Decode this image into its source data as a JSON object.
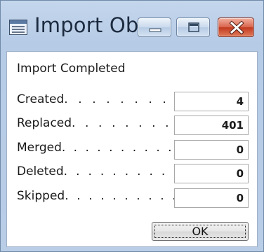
{
  "window": {
    "title": "Import Ob...",
    "icons": {
      "app": "dialog-app-icon",
      "minimize": "minimize-icon",
      "maximize": "maximize-icon",
      "close": "close-icon"
    },
    "colors": {
      "close_button": "#c23a1f",
      "frame": "#b9cde7"
    }
  },
  "dialog": {
    "header": "Import Completed",
    "fields": [
      {
        "label": "Created",
        "dots": ". . . . . . . . .",
        "value": "4"
      },
      {
        "label": "Replaced",
        "dots": ". . . . . . . . .",
        "value": "401"
      },
      {
        "label": "Merged",
        "dots": ". . . . . . . . . .",
        "value": "0"
      },
      {
        "label": "Deleted",
        "dots": ". . . . . . . . . .",
        "value": "0"
      },
      {
        "label": "Skipped",
        "dots": ". . . . . . . . . .",
        "value": "0"
      }
    ],
    "ok_label": "OK"
  }
}
